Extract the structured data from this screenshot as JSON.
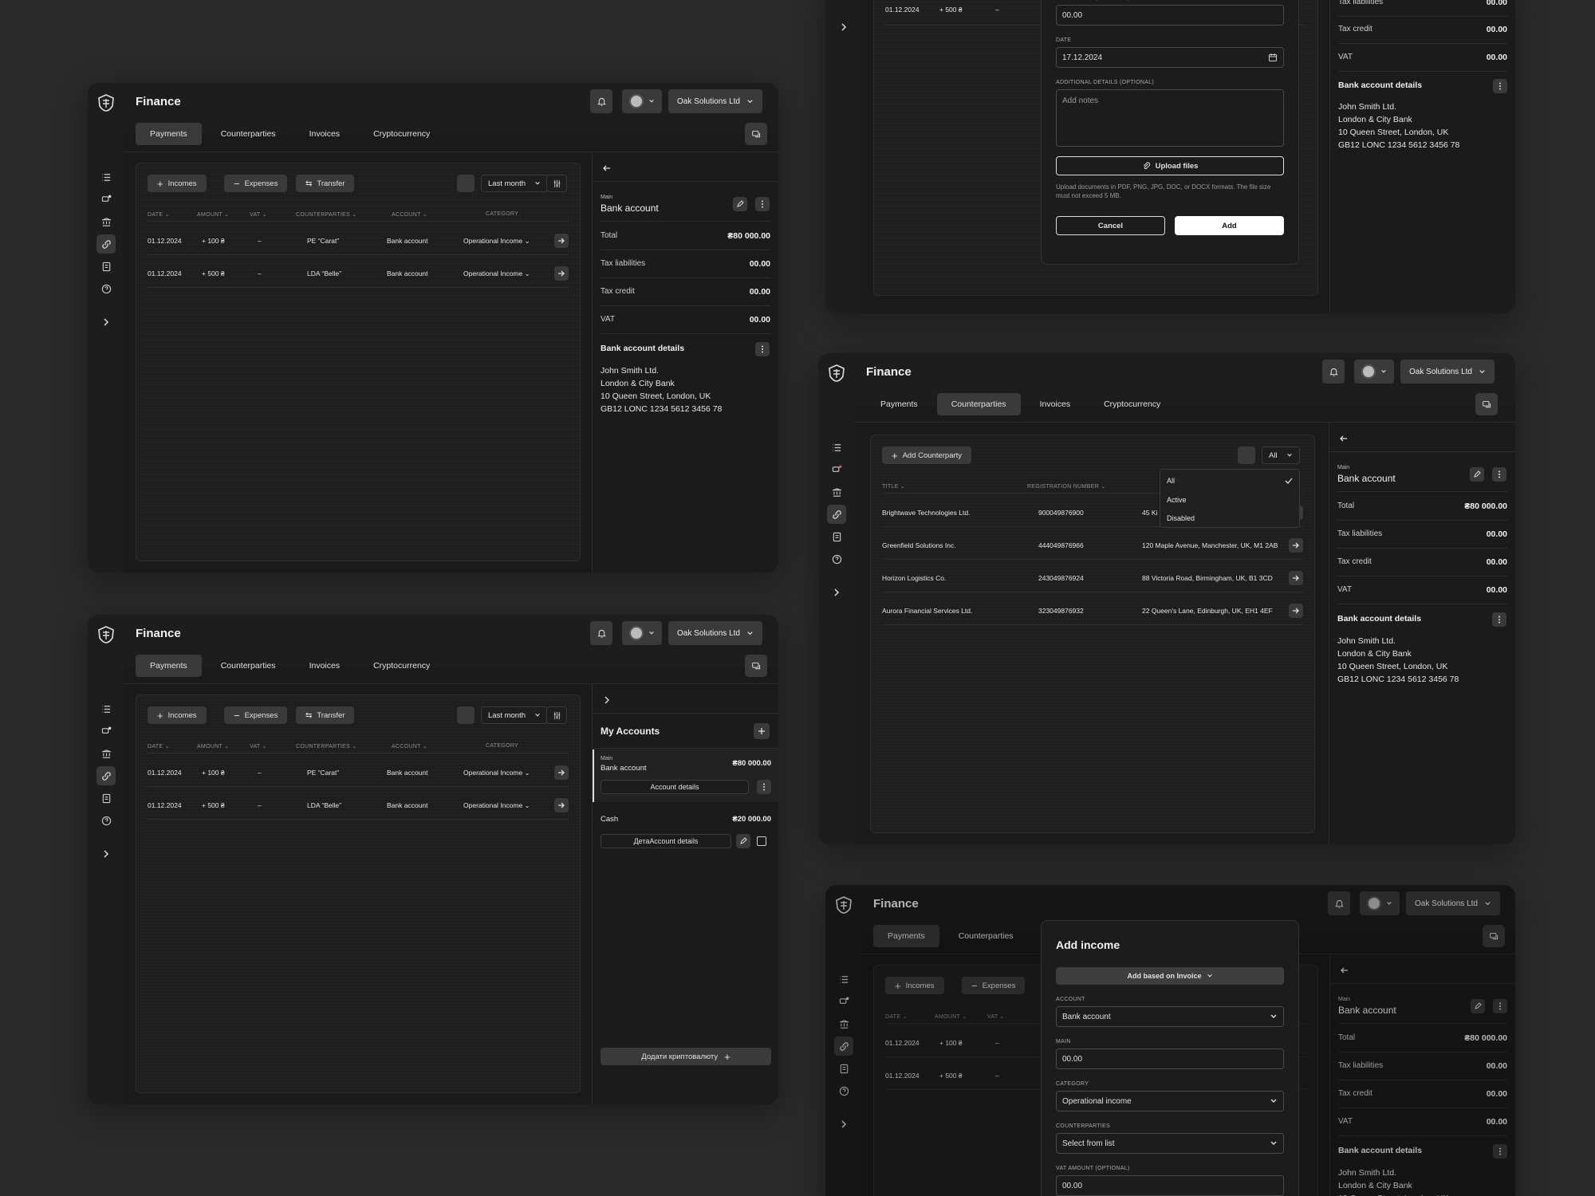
{
  "app": {
    "title": "Finance",
    "company": "Oak Solutions Ltd"
  },
  "tabs": [
    "Payments",
    "Counterparties",
    "Invoices",
    "Cryptocurrency"
  ],
  "payments": {
    "buttons": {
      "incomes": "Incomes",
      "expenses": "Expenses",
      "transfer": "Transfer"
    },
    "period": "Last month",
    "columns": [
      "DATE",
      "AMOUNT",
      "VAT",
      "COUNTERPARTIES",
      "ACCOUNT",
      "CATEGORY"
    ],
    "rows": [
      {
        "date": "01.12.2024",
        "amount": "+ 100 ₴",
        "vat": "–",
        "counterparty": "PE “Carat”",
        "account": "Bank account",
        "category": "Operational Income"
      },
      {
        "date": "01.12.2024",
        "amount": "+ 500 ₴",
        "vat": "–",
        "counterparty": "LDA “Belle”",
        "account": "Bank account",
        "category": "Operational Income"
      }
    ]
  },
  "account": {
    "main_label": "Main",
    "name": "Bank account",
    "total_label": "Total",
    "total": "₴80 000.00",
    "tax_liab_label": "Tax liabilities",
    "tax_liab": "00.00",
    "tax_credit_label": "Tax credit",
    "tax_credit": "00.00",
    "vat_label": "VAT",
    "vat": "00.00",
    "details_title": "Bank account details",
    "details": "John Smith Ltd.\nLondon & City Bank\n10 Queen Street, London, UK\nGB12 LONC 1234 5612 3456 78"
  },
  "my_accounts": {
    "title": "My Accounts",
    "main_label": "Main",
    "main_name": "Bank account",
    "main_value": "₴80 000.00",
    "main_btn": "Account details",
    "cash_name": "Cash",
    "cash_value": "₴20 000.00",
    "cash_btn": "ДетаAccount details",
    "crypto_btn": "Додати криптовалюту"
  },
  "counterparties": {
    "add_btn": "Add Counterparty",
    "filter": "All",
    "filter_options": [
      "All",
      "Active",
      "Disabled"
    ],
    "columns": [
      "TITLE",
      "REGISTRATION NUMBER"
    ],
    "rows": [
      {
        "title": "Brightwave Technologies Ltd.",
        "reg": "900049876900",
        "addr": "45 Ki"
      },
      {
        "title": "Greenfield Solutions Inc.",
        "reg": "444049876966",
        "addr": "120 Maple Avenue, Manchester, UK, M1 2AB"
      },
      {
        "title": "Horizon Logistics Co.",
        "reg": "243049876924",
        "addr": "88 Victoria Road, Birmingham, UK, B1 3CD"
      },
      {
        "title": "Aurora Financial Services Ltd.",
        "reg": "323049876932",
        "addr": "22 Queen's Lane, Edinburgh, UK, EH1 4EF"
      }
    ]
  },
  "add_income": {
    "title": "Add income",
    "based_btn": "Add based on Invoice",
    "account_label": "ACCOUNT",
    "account_value": "Bank account",
    "main_label": "MAIN",
    "main_value": "00.00",
    "category_label": "CATEGORY",
    "category_value": "Operational income",
    "counterparties_label": "COUNTERPARTIES",
    "counterparties_value": "Select from list",
    "vat_label": "VAT AMOUNT (OPTIONAL)",
    "vat_value": "00.00",
    "date_label": "DATE",
    "date_value": "17.12.2024",
    "notes_label": "ADDITIONAL DETAILS (OPTIONAL)",
    "notes_placeholder": "Add notes",
    "upload_btn": "Upload files",
    "upload_hint": "Upload documents in PDF, PNG, JPG, DOC, or DOCX formats. The file size must not exceed 5 MB.",
    "cancel": "Cancel",
    "add": "Add"
  },
  "top_partial": {
    "date": "01.12.2024",
    "amount": "+ 500 ₴",
    "vat": "–"
  }
}
